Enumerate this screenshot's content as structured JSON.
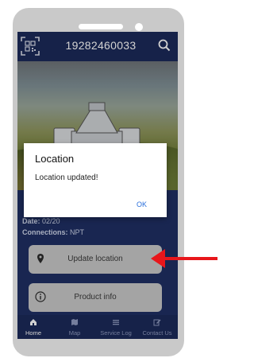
{
  "header": {
    "title": "19282460033",
    "left_icon": "qr-code-icon",
    "right_icon": "search-icon"
  },
  "info": {
    "date_label": "Date:",
    "date_value": "02/20",
    "connections_label": "Connections:",
    "connections_value": "NPT"
  },
  "dialog": {
    "title": "Location",
    "message": "Location updated!",
    "ok_label": "OK"
  },
  "buttons": {
    "update_location": "Update location",
    "product_info": "Product info"
  },
  "nav": {
    "items": [
      {
        "label": "Home",
        "icon": "home-icon"
      },
      {
        "label": "Map",
        "icon": "map-icon"
      },
      {
        "label": "Service Log",
        "icon": "list-icon"
      },
      {
        "label": "Contact Us",
        "icon": "edit-icon"
      }
    ]
  },
  "colors": {
    "screen_bg": "#1f2f63",
    "appbar_bg": "#1c2a59",
    "button_bg": "#c9c9c9",
    "annotation_arrow": "#e8161b",
    "dialog_accent": "#2a6fdb"
  }
}
